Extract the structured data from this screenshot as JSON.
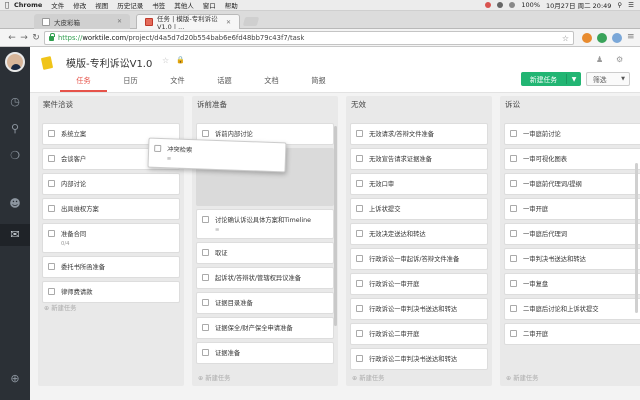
{
  "menubar": {
    "app": "Chrome",
    "items": [
      "文件",
      "修改",
      "视图",
      "历史记录",
      "书签",
      "其他人",
      "窗口",
      "帮助"
    ],
    "battery": "100%",
    "datetime": "10月27日 周二  20:49"
  },
  "tabs": [
    {
      "title": "大皮彩箱",
      "active": false
    },
    {
      "title": "任务 | 模版-专利诉讼V1.0 | ...",
      "active": true
    }
  ],
  "address": {
    "secure_part": "https://",
    "host": "worktile.com",
    "path": "/project/d4a5d7d20b554bab6e6fd48bb79c43f7/task"
  },
  "project": {
    "title": "模版-专利诉讼V1.0"
  },
  "nav": [
    {
      "label": "任务",
      "active": true
    },
    {
      "label": "日历",
      "active": false
    },
    {
      "label": "文件",
      "active": false
    },
    {
      "label": "话题",
      "active": false
    },
    {
      "label": "文档",
      "active": false
    },
    {
      "label": "简报",
      "active": false
    }
  ],
  "toolbar": {
    "new_task": "新建任务",
    "filter": "筛选"
  },
  "add_task_label": "新建任务",
  "columns": [
    {
      "title": "案件洽谈",
      "cards": [
        {
          "text": "系统立案"
        },
        {
          "text": "会谈客户"
        },
        {
          "text": "内部讨论"
        },
        {
          "text": "出具维权方案"
        },
        {
          "text": "准备合同",
          "meta": "0/4"
        },
        {
          "text": "委托书所函准备"
        },
        {
          "text": "律师费请款"
        }
      ]
    },
    {
      "title": "诉前准备",
      "cards": [
        {
          "text": "诉前内部讨论"
        },
        {
          "text": "讨论确认诉讼具体方案和Timeline",
          "meta": "≡"
        },
        {
          "text": "取证"
        },
        {
          "text": "起诉状/答辩状/管辖权异议准备"
        },
        {
          "text": "证据目录准备"
        },
        {
          "text": "证据保全/财产保全申请准备"
        },
        {
          "text": "证据准备"
        }
      ]
    },
    {
      "title": "无效",
      "cards": [
        {
          "text": "无效请求/答辩文件准备"
        },
        {
          "text": "无效宣告请求证据准备"
        },
        {
          "text": "无效口审"
        },
        {
          "text": "上诉状提交"
        },
        {
          "text": "无效决定送达和转达"
        },
        {
          "text": "行政诉讼一审起诉/答辩文件准备"
        },
        {
          "text": "行政诉讼一审开庭"
        },
        {
          "text": "行政诉讼一审判决书送达和转达"
        },
        {
          "text": "行政诉讼二审开庭"
        },
        {
          "text": "行政诉讼二审判决书送达和转达"
        }
      ]
    },
    {
      "title": "诉讼",
      "cards": [
        {
          "text": "一审庭前讨论"
        },
        {
          "text": "一审可视化图表"
        },
        {
          "text": "一审庭前代理词/提纲"
        },
        {
          "text": "一审开庭"
        },
        {
          "text": "一审庭后代理词"
        },
        {
          "text": "一审判决书送达和转达"
        },
        {
          "text": "一审复盘"
        },
        {
          "text": "二审庭后讨论和上诉状提交"
        },
        {
          "text": "二审开庭"
        }
      ]
    }
  ],
  "dragging_card": {
    "text": "冲突检索",
    "meta": "≡"
  }
}
